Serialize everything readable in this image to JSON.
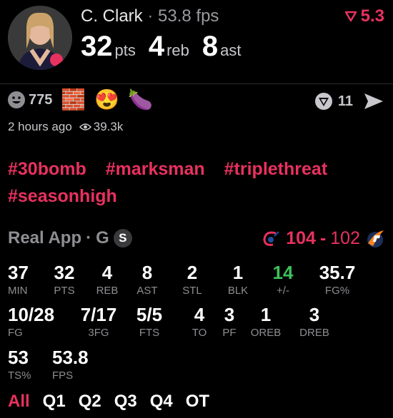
{
  "header": {
    "player_name": "C. Clark",
    "separator": "·",
    "fps_text": "53.8 fps",
    "change_value": "5.3",
    "colors": {
      "accent": "#e8315f",
      "positive": "#3fbf5b"
    }
  },
  "headline_stats": [
    {
      "value": "32",
      "unit": "pts"
    },
    {
      "value": "4",
      "unit": "reb"
    },
    {
      "value": "8",
      "unit": "ast"
    }
  ],
  "reactions": {
    "smile_count": "775",
    "emojis": [
      "🧱",
      "😍",
      "🍆"
    ]
  },
  "share": {
    "reply_count": "11"
  },
  "meta": {
    "time_ago": "2 hours ago",
    "views": "39.3k"
  },
  "hashtags": [
    "#30bomb",
    "#marksman",
    "#triplethreat",
    "#seasonhigh"
  ],
  "game": {
    "source": "Real App",
    "separator": "·",
    "status": "G",
    "badge": "S",
    "home_score": "104",
    "dash": "-",
    "away_score": "102"
  },
  "stats_row1": [
    {
      "value": "37",
      "label": "MIN"
    },
    {
      "value": "32",
      "label": "PTS"
    },
    {
      "value": "4",
      "label": "REB"
    },
    {
      "value": "8",
      "label": "AST"
    },
    {
      "value": "2",
      "label": "STL"
    },
    {
      "value": "1",
      "label": "BLK"
    },
    {
      "value": "14",
      "label": "+/-"
    },
    {
      "value": "35.7",
      "label": "FG%"
    }
  ],
  "stats_row2": [
    {
      "value": "10/28",
      "label": "FG"
    },
    {
      "value": "7/17",
      "label": "3FG"
    },
    {
      "value": "5/5",
      "label": "FTS"
    },
    {
      "value": "4",
      "label": "TO"
    },
    {
      "value": "3",
      "label": "PF"
    },
    {
      "value": "1",
      "label": "OREB"
    },
    {
      "value": "3",
      "label": "DREB"
    }
  ],
  "stats_row3": [
    {
      "value": "53",
      "label": "TS%"
    },
    {
      "value": "53.8",
      "label": "FPS"
    }
  ],
  "periods": [
    "All",
    "Q1",
    "Q2",
    "Q3",
    "Q4",
    "OT"
  ]
}
